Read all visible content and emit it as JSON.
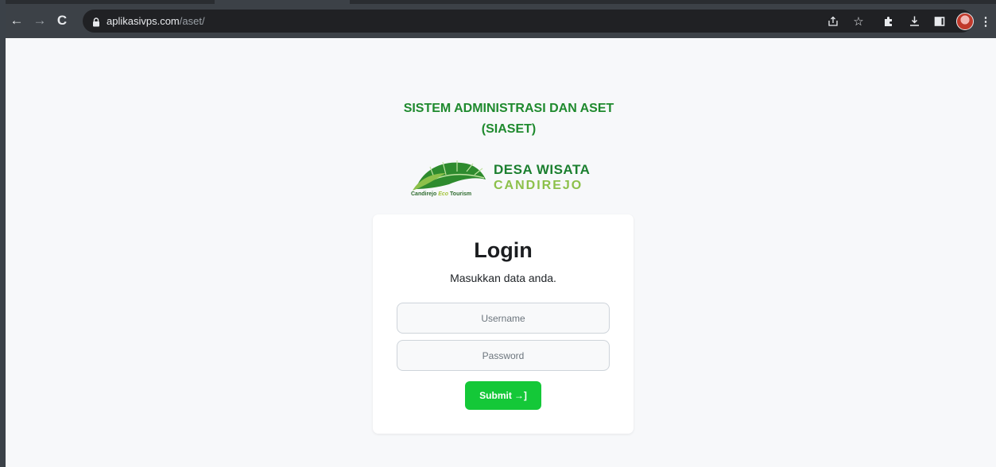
{
  "browser": {
    "url_domain": "aplikasivps.com",
    "url_path": "/aset/",
    "icons": [
      "back-icon",
      "forward-icon",
      "reload-icon",
      "lock-icon",
      "share-icon",
      "star-icon",
      "extensions-icon",
      "download-icon",
      "sidepanel-icon",
      "profile-avatar",
      "menu-icon"
    ]
  },
  "header": {
    "title_line1": "SISTEM ADMINISTRASI DAN ASET",
    "title_line2": "(SIASET)"
  },
  "logo": {
    "name_line1": "DESA WISATA",
    "name_line2": "CANDIREJO",
    "caption_a": "Candirejo",
    "caption_b": "Eco",
    "caption_c": "Tourism"
  },
  "login": {
    "title": "Login",
    "subtitle": "Masukkan data anda.",
    "username_placeholder": "Username",
    "password_placeholder": "Password",
    "submit_label": "Submit",
    "submit_icon": "→]"
  },
  "colors": {
    "brand_green": "#1f8a2e",
    "accent_light_green": "#8cc04a",
    "button_green": "#14c838",
    "chrome_bg": "#3c4147"
  }
}
